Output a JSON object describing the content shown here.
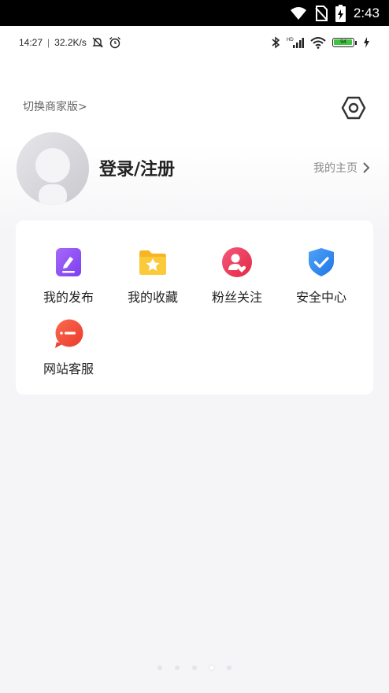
{
  "system_bar": {
    "time": "2:43"
  },
  "status_row": {
    "time": "14:27",
    "speed": "32.2K/s",
    "battery": "94"
  },
  "header": {
    "switch_merchant": "切换商家版>"
  },
  "profile": {
    "login_label": "登录/注册",
    "homepage_link": "我的主页"
  },
  "menu": {
    "items": [
      {
        "label": "我的发布",
        "icon": "edit-icon",
        "color": "#8e4ef6"
      },
      {
        "label": "我的收藏",
        "icon": "folder-star-icon",
        "color": "#f9b828"
      },
      {
        "label": "粉丝关注",
        "icon": "fans-icon",
        "color": "#ee3d5a"
      },
      {
        "label": "安全中心",
        "icon": "shield-check-icon",
        "color": "#2f88f2"
      },
      {
        "label": "网站客服",
        "icon": "chat-icon",
        "color": "#f24d3c"
      }
    ]
  },
  "page_indicator": {
    "count": 5,
    "active_index": 3
  }
}
